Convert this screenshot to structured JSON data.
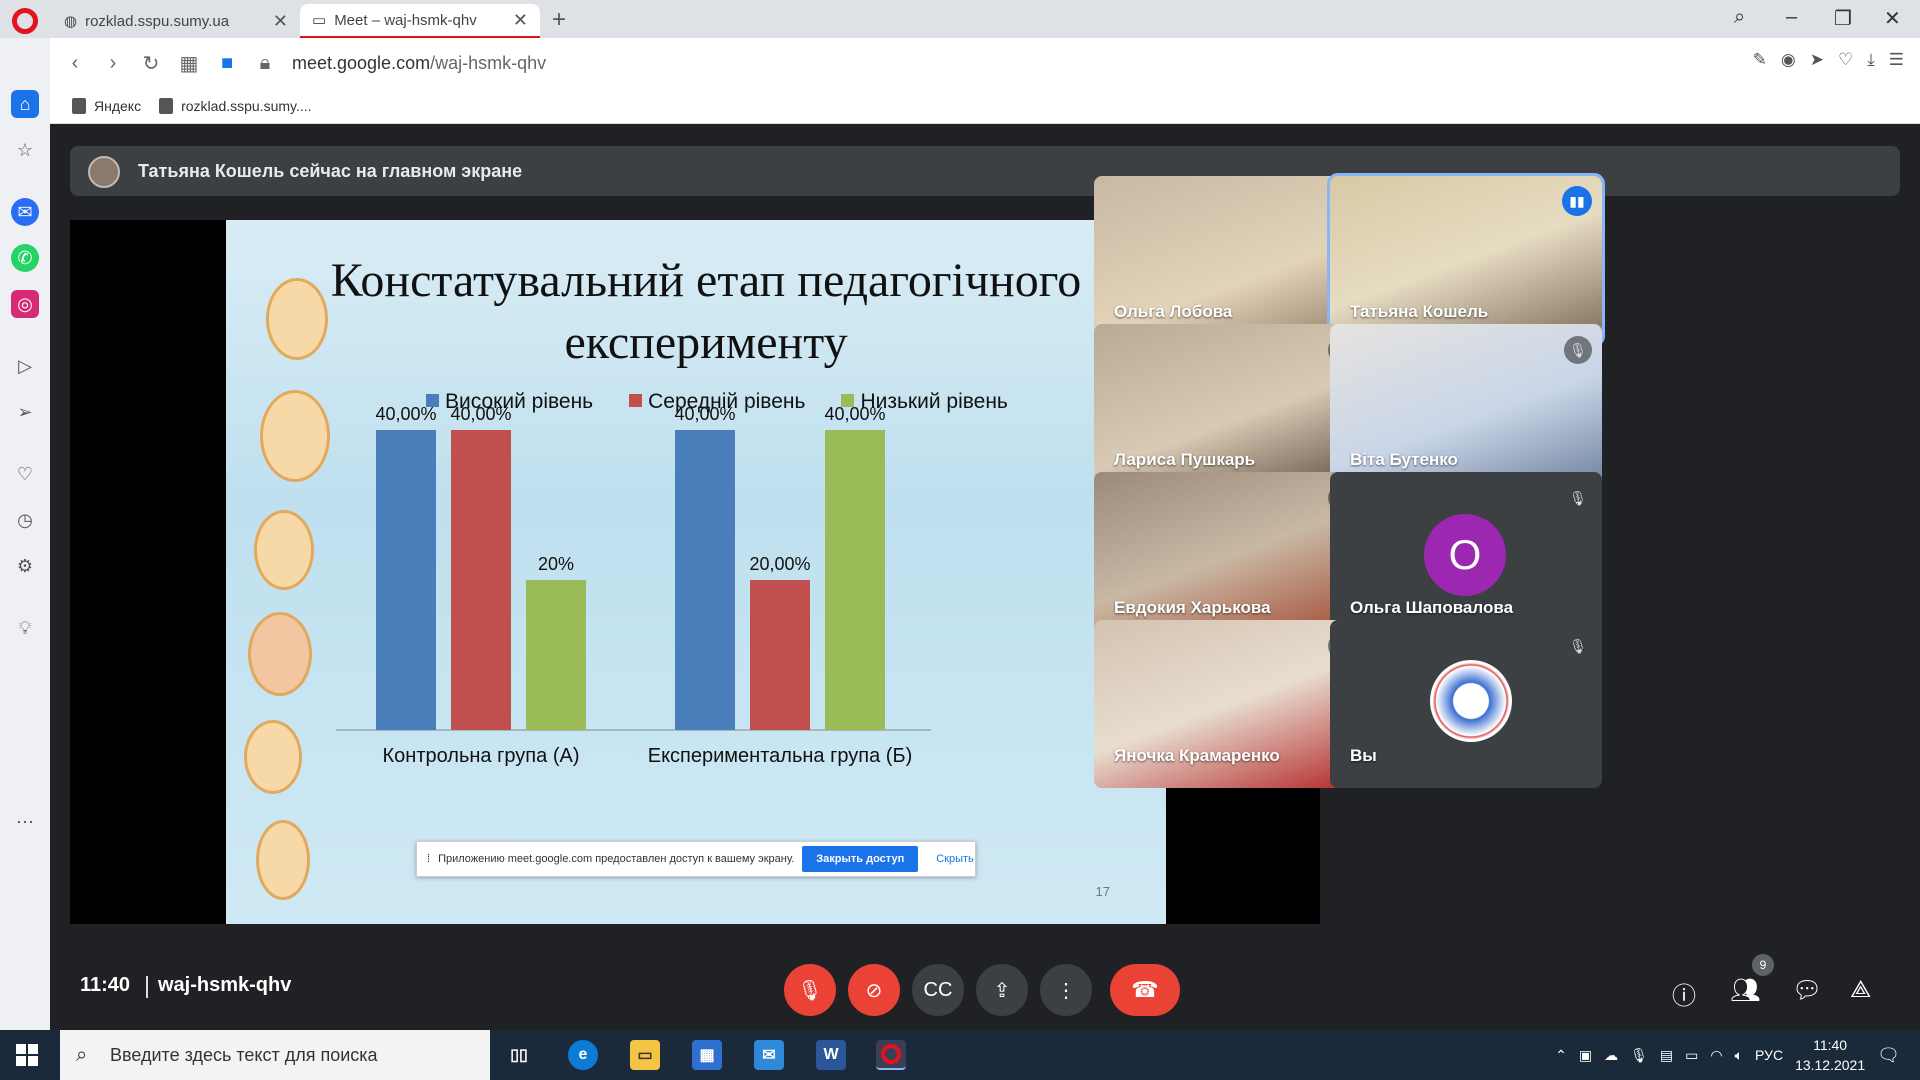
{
  "browser": {
    "tabs": [
      {
        "label": "rozklad.sspu.sumy.ua",
        "active": false
      },
      {
        "label": "Meet – waj-hsmk-qhv",
        "active": true
      }
    ],
    "url_host": "meet.google.com",
    "url_path": "/waj-hsmk-qhv",
    "bookmarks": [
      "Яндекс",
      "rozklad.sspu.sumy...."
    ]
  },
  "meet": {
    "banner_text": "Татьяна Кошель сейчас на главном экране",
    "slide": {
      "title_line1": "Констатувальний етап педагогічного",
      "title_line2": "експерименту",
      "page_number": "17",
      "share_popup": {
        "message": "Приложению meet.google.com предоставлен доступ к вашему экрану.",
        "stop_label": "Закрыть доступ",
        "hide_label": "Скрыть"
      }
    },
    "participants": [
      {
        "name": "Ольга Лобова",
        "muted": false
      },
      {
        "name": "Татьяна Кошель",
        "speaking": true
      },
      {
        "name": "Лариса Пушкарь",
        "muted": true
      },
      {
        "name": "Віта Бутенко",
        "muted": true
      },
      {
        "name": "Евдокия Харькова",
        "muted": true
      },
      {
        "name": "Ольга Шаповалова",
        "muted": true,
        "avatar_letter": "O"
      },
      {
        "name": "Яночка Крамаренко",
        "muted": true
      },
      {
        "name": "Вы",
        "muted": true
      }
    ],
    "controls": {
      "time": "11:40",
      "meeting_code": "waj-hsmk-qhv",
      "participants_count": "9"
    }
  },
  "taskbar": {
    "search_placeholder": "Введите здесь текст для поиска",
    "lang": "РУС",
    "time": "11:40",
    "date": "13.12.2021"
  },
  "chart_data": {
    "type": "bar",
    "categories": [
      "Контрольна група (А)",
      "Експериментальна група (Б)"
    ],
    "series": [
      {
        "name": "Високий рівень",
        "color": "#4a7ebb",
        "values": [
          40,
          40
        ],
        "labels": [
          "40,00%",
          "40,00%"
        ]
      },
      {
        "name": "Середній рівень",
        "color": "#c0504d",
        "values": [
          40,
          20
        ],
        "labels": [
          "40,00%",
          "20,00%"
        ]
      },
      {
        "name": "Низький рівень",
        "color": "#9bbb59",
        "values": [
          20,
          40
        ],
        "labels": [
          "20%",
          "40,00%"
        ]
      }
    ],
    "ylim": [
      0,
      40
    ]
  }
}
